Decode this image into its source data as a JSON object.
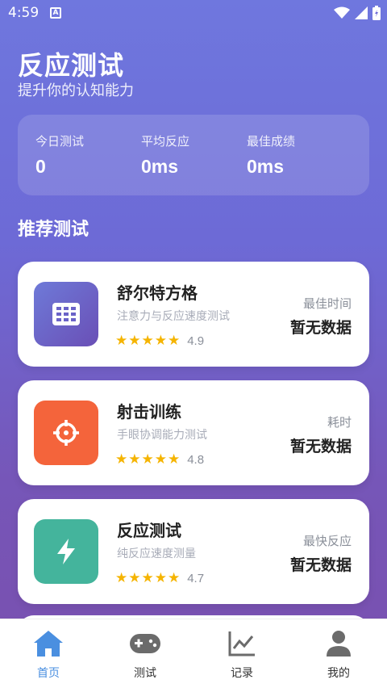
{
  "status_bar": {
    "time": "4:59"
  },
  "header": {
    "title": "反应测试",
    "subtitle": "提升你的认知能力"
  },
  "stats": [
    {
      "label": "今日测试",
      "value": "0"
    },
    {
      "label": "平均反应",
      "value": "0ms"
    },
    {
      "label": "最佳成绩",
      "value": "0ms"
    }
  ],
  "section_title": "推荐测试",
  "tests": [
    {
      "name": "舒尔特方格",
      "desc": "注意力与反应速度测试",
      "stars": "★★★★★",
      "rating": "4.9",
      "metric_label": "最佳时间",
      "metric_value": "暂无数据",
      "icon": "grid-icon",
      "color": "#6a5fc8"
    },
    {
      "name": "射击训练",
      "desc": "手眼协调能力测试",
      "stars": "★★★★★",
      "rating": "4.8",
      "metric_label": "耗时",
      "metric_value": "暂无数据",
      "icon": "crosshair-icon",
      "color": "#f4643b"
    },
    {
      "name": "反应测试",
      "desc": "纯反应速度测量",
      "stars": "★★★★★",
      "rating": "4.7",
      "metric_label": "最快反应",
      "metric_value": "暂无数据",
      "icon": "lightning-icon",
      "color": "#44b49c"
    }
  ],
  "nav": [
    {
      "label": "首页",
      "icon": "home-icon",
      "active": true
    },
    {
      "label": "测试",
      "icon": "gamepad-icon",
      "active": false
    },
    {
      "label": "记录",
      "icon": "chart-icon",
      "active": false
    },
    {
      "label": "我的",
      "icon": "user-icon",
      "active": false
    }
  ],
  "colors": {
    "accent": "#4a8fe0",
    "star": "#f5b400"
  }
}
